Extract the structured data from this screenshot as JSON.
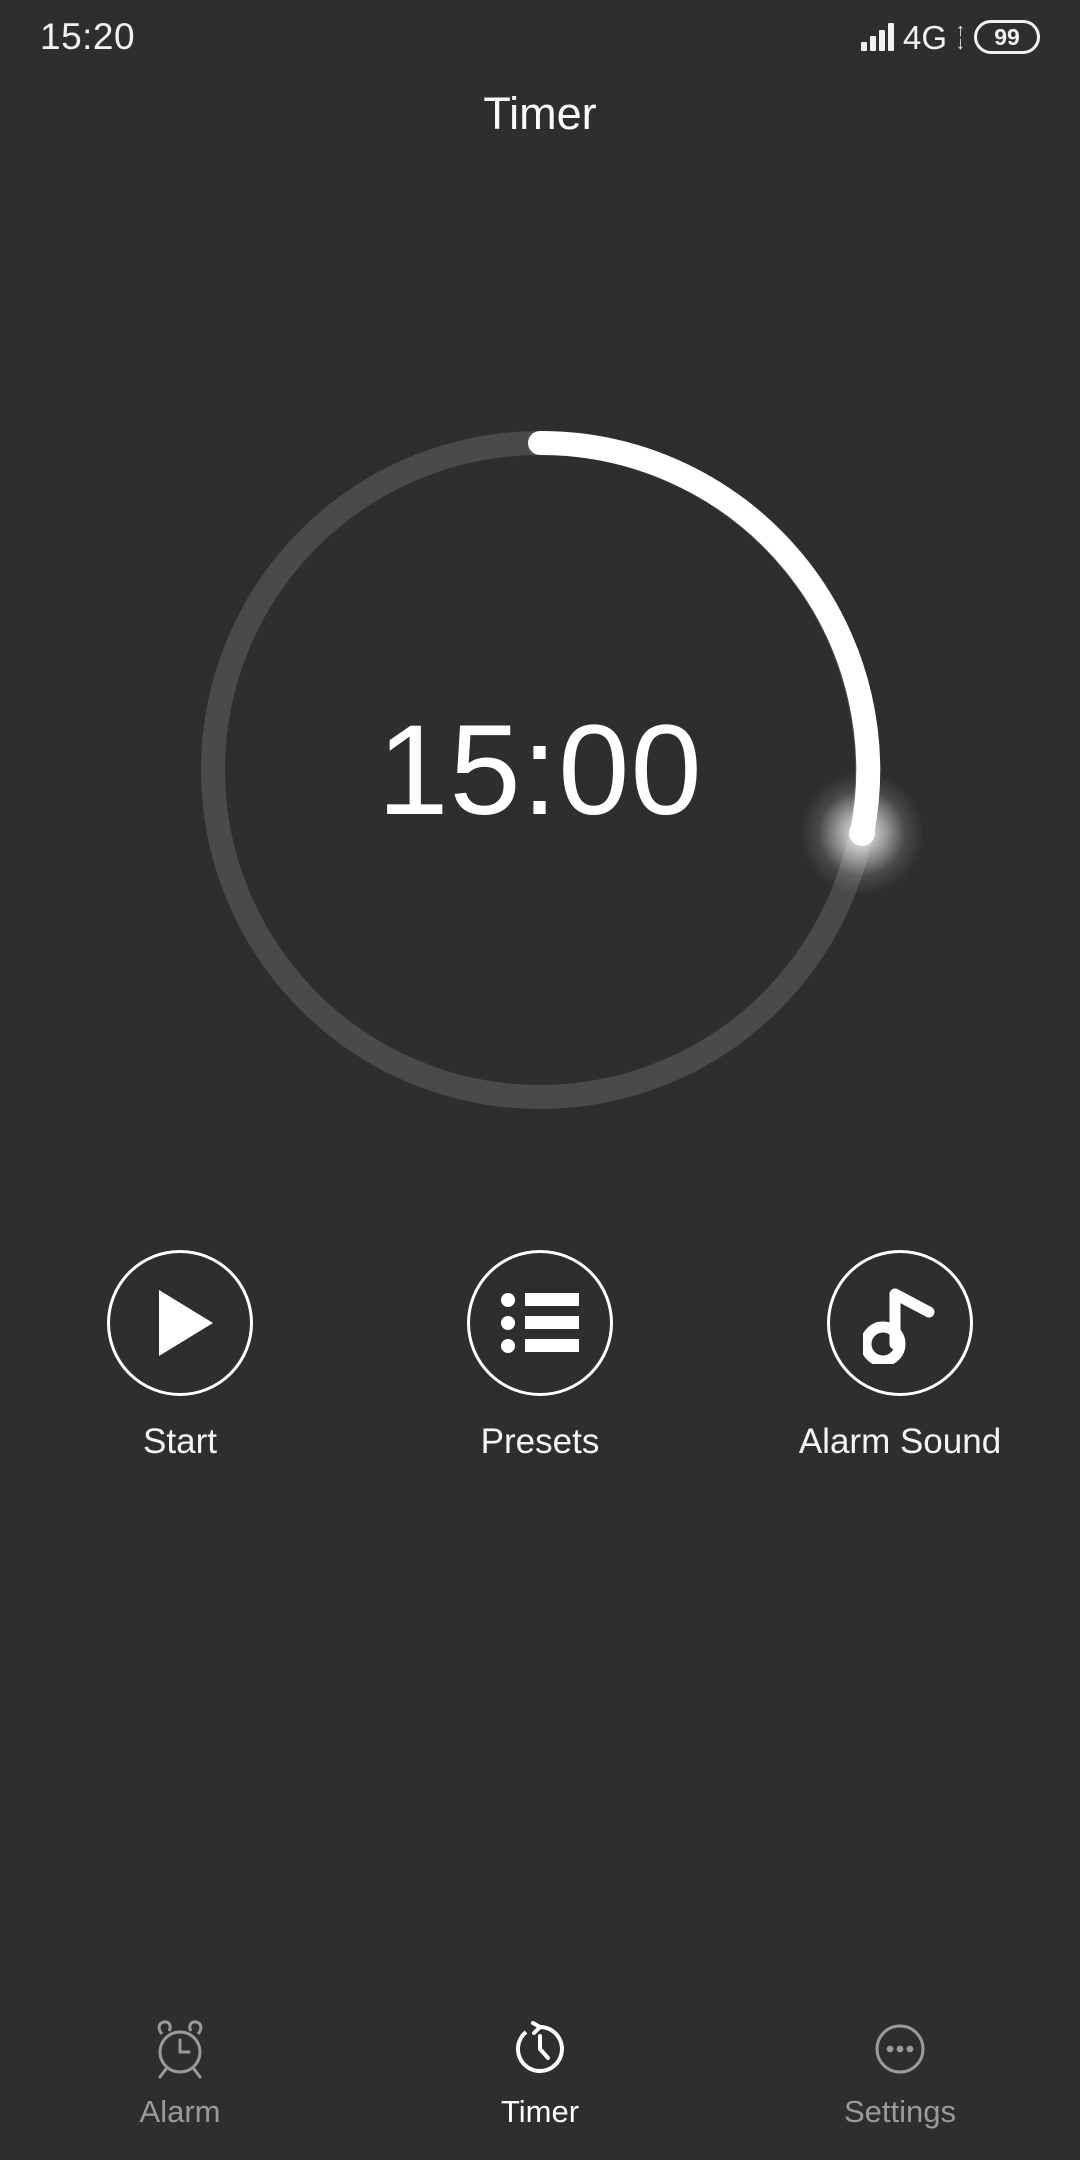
{
  "status_bar": {
    "time": "15:20",
    "network_label": "4G",
    "battery_level": "99",
    "signal_icon": "signal-bars-icon",
    "data_arrows_icon": "data-transfer-arrows-icon",
    "battery_icon": "battery-icon"
  },
  "header": {
    "title": "Timer"
  },
  "dial": {
    "time_display": "15:00",
    "progress_percent": 28,
    "progress_degrees": 100,
    "track_color": "#4a4a4a",
    "progress_color": "#ffffff",
    "background_color": "#2e2e2e"
  },
  "controls": [
    {
      "label": "Start",
      "icon": "play-icon"
    },
    {
      "label": "Presets",
      "icon": "list-icon"
    },
    {
      "label": "Alarm Sound",
      "icon": "music-note-icon"
    }
  ],
  "bottom_nav": [
    {
      "label": "Alarm",
      "icon": "alarm-clock-icon",
      "active": false
    },
    {
      "label": "Timer",
      "icon": "timer-clock-icon",
      "active": true
    },
    {
      "label": "Settings",
      "icon": "more-dots-icon",
      "active": false
    }
  ]
}
